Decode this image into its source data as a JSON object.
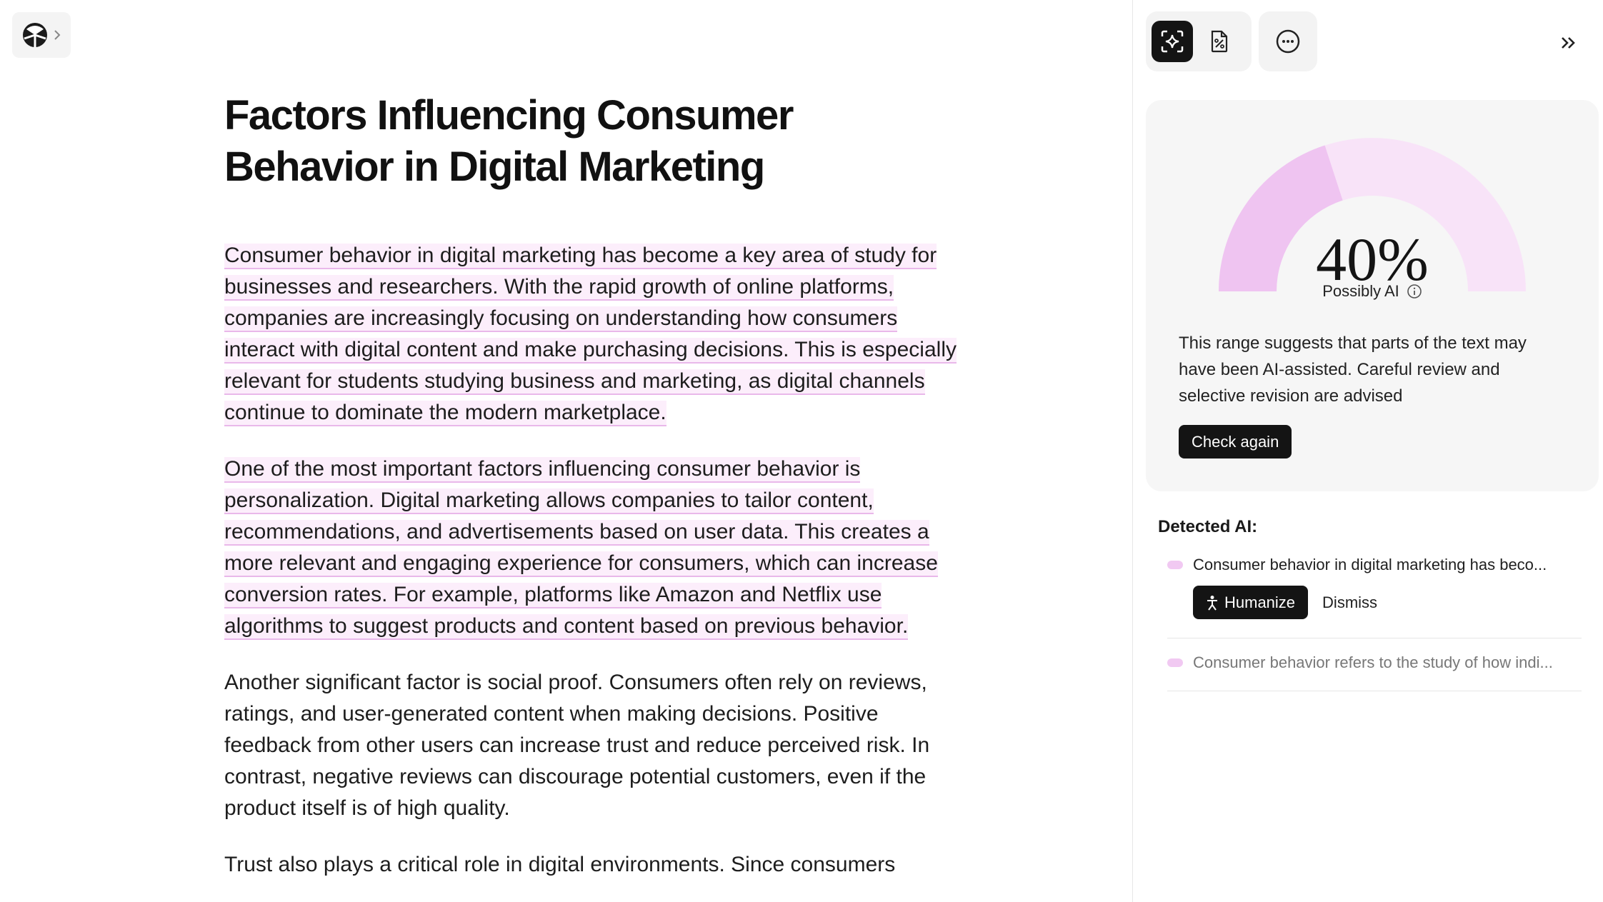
{
  "document": {
    "title": "Factors Influencing Consumer Behavior in Digital Marketing",
    "paragraphs": [
      {
        "text": "Consumer behavior in digital marketing has become a key area of study for businesses and researchers. With the rapid growth of online platforms, companies are increasingly focusing on understanding how consumers interact with digital content and make purchasing decisions. This is especially relevant for students studying business and marketing, as digital channels continue to dominate the modern marketplace.",
        "flagged": true
      },
      {
        "text": "One of the most important factors influencing consumer behavior is personalization. Digital marketing allows companies to tailor content, recommendations, and advertisements based on user data. This creates a more relevant and engaging experience for consumers, which can increase conversion rates. For example, platforms like Amazon and Netflix use algorithms to suggest products and content based on previous behavior.",
        "flagged": true
      },
      {
        "text": "Another significant factor is social proof. Consumers often rely on reviews, ratings, and user-generated content when making decisions. Positive feedback from other users can increase trust and reduce perceived risk. In contrast, negative reviews can discourage potential customers, even if the product itself is of high quality.",
        "flagged": false
      },
      {
        "text": "Trust also plays a critical role in digital environments. Since consumers",
        "flagged": false
      }
    ]
  },
  "panel": {
    "toolbar": {
      "icons": [
        "ai-detector-icon",
        "document-percent-icon",
        "more-icon",
        "collapse-double-chevron-icon"
      ]
    },
    "score": {
      "percent": "40%",
      "value": 0.4,
      "label": "Possibly AI",
      "description": "This range suggests that parts of the text may have been AI-assisted. Careful review and selective revision are advised",
      "check_again_label": "Check again"
    },
    "detected": {
      "title": "Detected AI:",
      "items": [
        {
          "text": "Consumer behavior in digital marketing has beco...",
          "active": true
        },
        {
          "text": "Consumer behavior refers to the study of how indi...",
          "active": false
        }
      ],
      "humanize_label": "Humanize",
      "dismiss_label": "Dismiss"
    }
  },
  "colors": {
    "highlight_bg": "#fceefb",
    "highlight_underline": "#e9b8ea",
    "gauge_fill": "#efc4f1",
    "gauge_track": "#f8e3f8",
    "dark": "#141414"
  }
}
